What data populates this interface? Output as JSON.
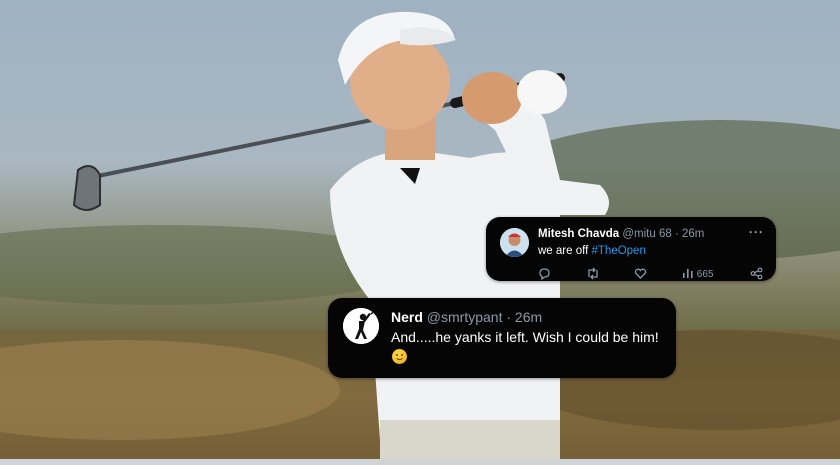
{
  "tweets": [
    {
      "name": "Mitesh Chavda",
      "handle": "@mitu 68",
      "time": "· 26m",
      "text_prefix": "we are off ",
      "hashtag": "#TheOpen",
      "more": "···",
      "views": "665"
    },
    {
      "name": "Nerd",
      "handle": "@smrtypant",
      "time": "· 26m",
      "text": "And.....he yanks it left. Wish I could be him!",
      "emoji": "slightly-smiling-face"
    }
  ]
}
